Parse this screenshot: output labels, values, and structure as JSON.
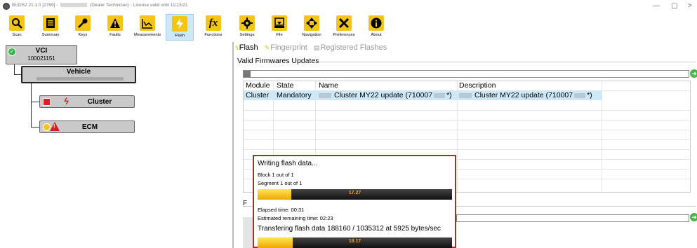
{
  "titlebar": {
    "title_prefix": "BUDS2 21.1.0 [2769] -",
    "title_role": "(Dealer Technician)",
    "title_suffix": " - License valid until 11/23/21",
    "minimize": "—",
    "maximize": "▢",
    "close": ">"
  },
  "toolbar": {
    "items": [
      {
        "label": "Scan",
        "icon": "scan-icon"
      },
      {
        "label": "Summary",
        "icon": "summary-icon"
      },
      {
        "label": "Keys",
        "icon": "keys-icon"
      },
      {
        "label": "Faults",
        "icon": "faults-icon"
      },
      {
        "label": "Measurements",
        "icon": "measurements-icon"
      },
      {
        "label": "Flash",
        "icon": "flash-icon"
      },
      {
        "label": "Functions",
        "icon": "functions-icon"
      },
      {
        "label": "Settings",
        "icon": "settings-icon"
      },
      {
        "label": "File",
        "icon": "file-icon"
      },
      {
        "label": "Navigation",
        "icon": "navigation-icon"
      },
      {
        "label": "Preferences",
        "icon": "preferences-icon"
      },
      {
        "label": "About",
        "icon": "about-icon"
      }
    ]
  },
  "tree": {
    "vci": {
      "label": "VCI",
      "serial": "100021151"
    },
    "vehicle": {
      "label": "Vehicle"
    },
    "cluster": {
      "label": "Cluster"
    },
    "ecm": {
      "label": "ECM"
    }
  },
  "tabs": {
    "flash": "Flash",
    "fingerprint": "Fingerprint",
    "registered": "Registered Flashes"
  },
  "firmware": {
    "title": "Valid Firmwares Updates",
    "columns": [
      "Module",
      "State",
      "Name",
      "Description"
    ],
    "rows": [
      {
        "module": "Cluster",
        "state": "Mandatory",
        "name": "Cluster MY22 update (710007",
        "name_end": "*)",
        "description": "Cluster MY22 update (710007",
        "description_end": "*)"
      }
    ]
  },
  "lower": {
    "label": "F"
  },
  "progress": {
    "heading": "Writing flash data...",
    "block": "Block 1 out of 1",
    "segment": "Segment 1 out of 1",
    "bar1_value": "17.27",
    "bar1_fraction": 0.1727,
    "elapsed": "Elapsed time: 00:31",
    "remaining": "Estimated remaining time: 02:23",
    "transfer": "Transfering flash data  188160 / 1035312 at  5925 bytes/sec",
    "bar2_value": "18.17",
    "bar2_fraction": 0.1817
  },
  "colors": {
    "accent": "#f4c517",
    "selected_row": "#cde8f8",
    "dialog_border": "#b8232f",
    "error": "#d61f26",
    "ok": "#3bb54a"
  }
}
